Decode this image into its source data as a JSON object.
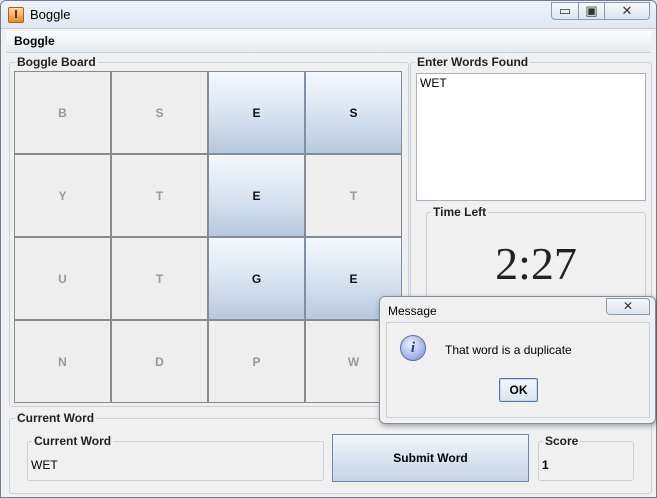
{
  "window": {
    "title": "Boggle",
    "buttons": {
      "minimize": "▭",
      "maximize": "▣",
      "close": "✕"
    }
  },
  "menu": {
    "items": [
      "Boggle"
    ]
  },
  "board": {
    "label": "Boggle Board",
    "tiles": [
      "B",
      "S",
      "E",
      "S",
      "Y",
      "T",
      "E",
      "T",
      "U",
      "T",
      "G",
      "E",
      "N",
      "D",
      "P",
      "W"
    ],
    "selected": [
      2,
      3,
      6,
      10,
      11
    ]
  },
  "words": {
    "label": "Enter Words Found",
    "text": "WET"
  },
  "timer": {
    "label": "Time Left",
    "value": "2:27"
  },
  "current_word": {
    "outer_label": "Current Word",
    "inner_label": "Current Word",
    "value": "WET"
  },
  "submit": {
    "label": "Submit Word"
  },
  "score": {
    "label": "Score",
    "value": "1"
  },
  "dialog": {
    "title": "Message",
    "close": "✕",
    "icon": "i",
    "message": "That word is a duplicate",
    "ok_label": "OK"
  },
  "colors": {
    "selected_tile": "#c5d5e8",
    "tile": "#eeeeee",
    "dim_letter": "#999999"
  }
}
